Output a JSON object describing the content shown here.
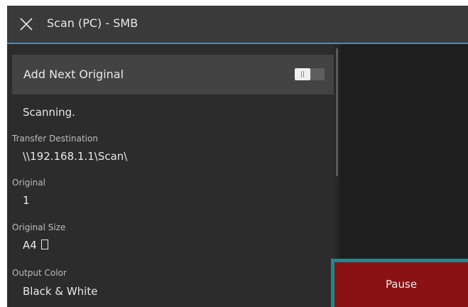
{
  "header": {
    "title": "Scan (PC) - SMB",
    "close_icon": "close-icon"
  },
  "add_next_original": {
    "label": "Add Next Original",
    "toggle_state": "off"
  },
  "status": "Scanning.",
  "fields": {
    "transfer_destination": {
      "label": "Transfer Destination",
      "value": "\\\\192.168.1.1\\Scan\\"
    },
    "original": {
      "label": "Original",
      "value": "1"
    },
    "original_size": {
      "label": "Original Size",
      "value": "A4",
      "orientation_icon": "portrait-page-icon"
    },
    "output_color": {
      "label": "Output Color",
      "value": "Black & White"
    }
  },
  "actions": {
    "pause_label": "Pause"
  },
  "colors": {
    "accent": "#3d8fd1",
    "pause_button": "#8b1212",
    "focus_outline": "#1a8a94"
  }
}
